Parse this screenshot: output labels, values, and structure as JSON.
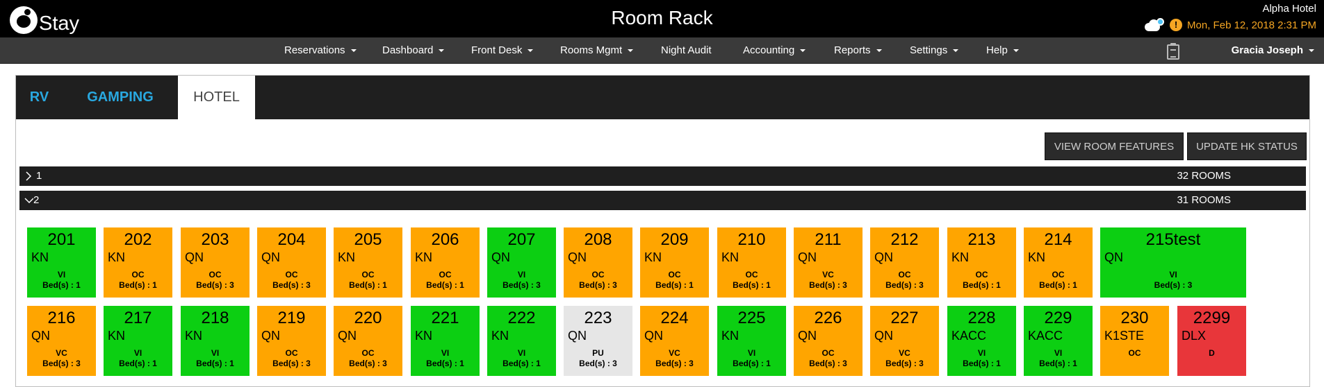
{
  "header": {
    "logo_text": "Stay",
    "title": "Room Rack",
    "hotel_name": "Alpha Hotel",
    "datetime": "Mon, Feb 12, 2018 2:31 PM",
    "warning_glyph": "!"
  },
  "nav": {
    "items": [
      {
        "label": "Reservations",
        "dropdown": true
      },
      {
        "label": "Dashboard",
        "dropdown": true
      },
      {
        "label": "Front Desk",
        "dropdown": true
      },
      {
        "label": "Rooms Mgmt",
        "dropdown": true
      },
      {
        "label": "Night Audit",
        "dropdown": false
      },
      {
        "label": "Accounting",
        "dropdown": true
      },
      {
        "label": "Reports",
        "dropdown": true
      },
      {
        "label": "Settings",
        "dropdown": true
      },
      {
        "label": "Help",
        "dropdown": true
      }
    ],
    "user": "Gracia Joseph"
  },
  "tabs": [
    {
      "label": "RV",
      "active": false
    },
    {
      "label": "GAMPING",
      "active": false
    },
    {
      "label": "HOTEL",
      "active": true
    }
  ],
  "actions": {
    "view_features": "VIEW ROOM FEATURES",
    "update_hk": "UPDATE HK STATUS"
  },
  "floors": [
    {
      "number": "1",
      "rooms_label": "32 ROOMS",
      "expanded": false
    },
    {
      "number": "2",
      "rooms_label": "31 ROOMS",
      "expanded": true
    }
  ],
  "colors": {
    "green": "#0ccf12",
    "orange": "#ffa500",
    "grey": "#e6e6e6",
    "red": "#e8363a",
    "tab_link": "#29a8e0",
    "datetime": "#f5a623"
  },
  "rooms": [
    {
      "number": "201",
      "type": "KN",
      "status": "VI",
      "beds": "Bed(s) : 1",
      "color": "green"
    },
    {
      "number": "202",
      "type": "KN",
      "status": "OC",
      "beds": "Bed(s) : 1",
      "color": "orange"
    },
    {
      "number": "203",
      "type": "QN",
      "status": "OC",
      "beds": "Bed(s) : 3",
      "color": "orange"
    },
    {
      "number": "204",
      "type": "QN",
      "status": "OC",
      "beds": "Bed(s) : 3",
      "color": "orange"
    },
    {
      "number": "205",
      "type": "KN",
      "status": "OC",
      "beds": "Bed(s) : 1",
      "color": "orange"
    },
    {
      "number": "206",
      "type": "KN",
      "status": "OC",
      "beds": "Bed(s) : 1",
      "color": "orange"
    },
    {
      "number": "207",
      "type": "QN",
      "status": "VI",
      "beds": "Bed(s) : 3",
      "color": "green"
    },
    {
      "number": "208",
      "type": "QN",
      "status": "OC",
      "beds": "Bed(s) : 3",
      "color": "orange"
    },
    {
      "number": "209",
      "type": "KN",
      "status": "OC",
      "beds": "Bed(s) : 1",
      "color": "orange"
    },
    {
      "number": "210",
      "type": "KN",
      "status": "OC",
      "beds": "Bed(s) : 1",
      "color": "orange"
    },
    {
      "number": "211",
      "type": "QN",
      "status": "VC",
      "beds": "Bed(s) : 3",
      "color": "orange"
    },
    {
      "number": "212",
      "type": "QN",
      "status": "OC",
      "beds": "Bed(s) : 3",
      "color": "orange"
    },
    {
      "number": "213",
      "type": "KN",
      "status": "OC",
      "beds": "Bed(s) : 1",
      "color": "orange"
    },
    {
      "number": "214",
      "type": "KN",
      "status": "OC",
      "beds": "Bed(s) : 1",
      "color": "orange"
    },
    {
      "number": "215test",
      "type": "QN",
      "status": "VI",
      "beds": "Bed(s) : 3",
      "color": "green",
      "wide": true
    },
    {
      "number": "216",
      "type": "QN",
      "status": "VC",
      "beds": "Bed(s) : 3",
      "color": "orange"
    },
    {
      "number": "217",
      "type": "KN",
      "status": "VI",
      "beds": "Bed(s) : 1",
      "color": "green"
    },
    {
      "number": "218",
      "type": "KN",
      "status": "VI",
      "beds": "Bed(s) : 1",
      "color": "green"
    },
    {
      "number": "219",
      "type": "QN",
      "status": "OC",
      "beds": "Bed(s) : 3",
      "color": "orange"
    },
    {
      "number": "220",
      "type": "QN",
      "status": "OC",
      "beds": "Bed(s) : 3",
      "color": "orange"
    },
    {
      "number": "221",
      "type": "KN",
      "status": "VI",
      "beds": "Bed(s) : 1",
      "color": "green"
    },
    {
      "number": "222",
      "type": "KN",
      "status": "VI",
      "beds": "Bed(s) : 1",
      "color": "green"
    },
    {
      "number": "223",
      "type": "QN",
      "status": "PU",
      "beds": "Bed(s) : 3",
      "color": "grey"
    },
    {
      "number": "224",
      "type": "QN",
      "status": "VC",
      "beds": "Bed(s) : 3",
      "color": "orange"
    },
    {
      "number": "225",
      "type": "KN",
      "status": "VI",
      "beds": "Bed(s) : 1",
      "color": "green"
    },
    {
      "number": "226",
      "type": "QN",
      "status": "OC",
      "beds": "Bed(s) : 3",
      "color": "orange"
    },
    {
      "number": "227",
      "type": "QN",
      "status": "VC",
      "beds": "Bed(s) : 3",
      "color": "orange"
    },
    {
      "number": "228",
      "type": "KACC",
      "status": "VI",
      "beds": "Bed(s) : 1",
      "color": "green"
    },
    {
      "number": "229",
      "type": "KACC",
      "status": "VI",
      "beds": "Bed(s) : 1",
      "color": "green"
    },
    {
      "number": "230",
      "type": "K1STE",
      "status": "OC",
      "beds": "",
      "color": "orange"
    },
    {
      "number": "2299",
      "type": "DLX",
      "status": "D",
      "beds": "",
      "color": "red"
    }
  ]
}
